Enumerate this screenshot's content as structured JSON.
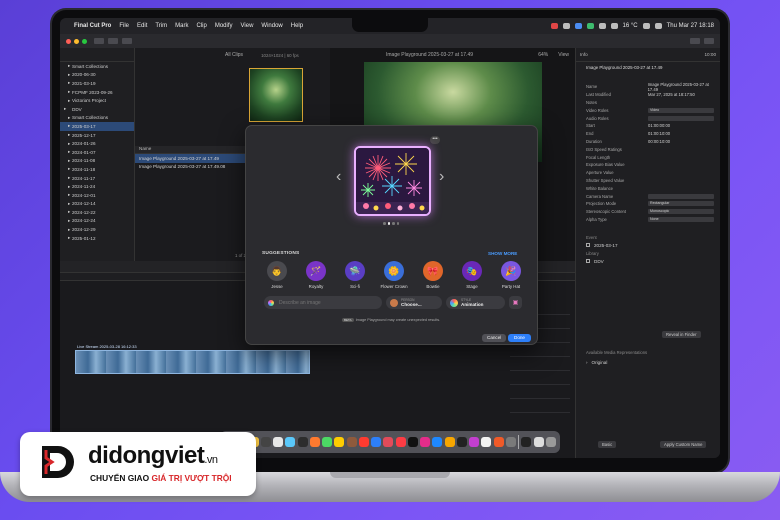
{
  "menubar": {
    "app": "Final Cut Pro",
    "items": [
      "File",
      "Edit",
      "Trim",
      "Mark",
      "Clip",
      "Modify",
      "View",
      "Window",
      "Help"
    ],
    "weather": "16 °C",
    "clock": "Thu Mar 27  18:18"
  },
  "library": {
    "items": [
      {
        "label": "Smart Collections",
        "indent": 1,
        "selected": false
      },
      {
        "label": "2020-06-30",
        "indent": 1,
        "selected": false
      },
      {
        "label": "2021-03-19",
        "indent": 1,
        "selected": false
      },
      {
        "label": "FCPMF 2023-09-26",
        "indent": 1,
        "selected": false
      },
      {
        "label": "Victoria's Project",
        "indent": 1,
        "selected": false
      },
      {
        "label": "DDV",
        "indent": 0,
        "selected": false
      },
      {
        "label": "Smart Collections",
        "indent": 1,
        "selected": false
      },
      {
        "label": "2025-03-17",
        "indent": 1,
        "selected": true
      },
      {
        "label": "2025-12-17",
        "indent": 1,
        "selected": false
      },
      {
        "label": "2024-01-26",
        "indent": 1,
        "selected": false
      },
      {
        "label": "2024-01-07",
        "indent": 1,
        "selected": false
      },
      {
        "label": "2024-11-08",
        "indent": 1,
        "selected": false
      },
      {
        "label": "2024-11-18",
        "indent": 1,
        "selected": false
      },
      {
        "label": "2024-11-17",
        "indent": 1,
        "selected": false
      },
      {
        "label": "2024-11-24",
        "indent": 1,
        "selected": false
      },
      {
        "label": "2024-12-01",
        "indent": 1,
        "selected": false
      },
      {
        "label": "2024-12-14",
        "indent": 1,
        "selected": false
      },
      {
        "label": "2024-12-22",
        "indent": 1,
        "selected": false
      },
      {
        "label": "2024-12-24",
        "indent": 1,
        "selected": false
      },
      {
        "label": "2024-12-29",
        "indent": 1,
        "selected": false
      },
      {
        "label": "2025-01-12",
        "indent": 1,
        "selected": false
      }
    ]
  },
  "browser": {
    "filter": "All Clips",
    "format": "1024×1024 | 60 fps",
    "thumb_caption": "Image Play...27 at 17:48",
    "column_header": "Name",
    "clips": [
      {
        "name": "Image Playground 2025-03-27 at 17.49",
        "selected": true
      },
      {
        "name": "Image Playground 2025-03-27 at 17.49.08",
        "selected": false
      }
    ],
    "selection_count": "1 of 2 selected, 10:00"
  },
  "viewer": {
    "title": "Image Playground 2025-03-27 at 17.49",
    "zoom": "64%",
    "view_menu": "View"
  },
  "inspector": {
    "tabs": "Info",
    "timecode": "10:00",
    "clip_name_value": "Image Playground 2025-03-27 at 17.49",
    "rows": [
      {
        "k": "Name",
        "v": "Image Playground 2025-03-27 at 17.49",
        "box": false
      },
      {
        "k": "Last Modified",
        "v": "Mar 27, 2025 at 18:17:50",
        "box": false
      },
      {
        "k": "Notes",
        "v": "",
        "box": false
      },
      {
        "k": "Video Roles",
        "v": "Video",
        "box": true
      },
      {
        "k": "Audio Roles",
        "v": "",
        "box": true
      },
      {
        "k": "Start",
        "v": "01:00:00:00",
        "box": false
      },
      {
        "k": "End",
        "v": "01:00:10:00",
        "box": false
      },
      {
        "k": "Duration",
        "v": "00:00:10:00",
        "box": false
      },
      {
        "k": "ISO Speed Ratings",
        "v": "",
        "box": false
      },
      {
        "k": "Focal Length",
        "v": "",
        "box": false
      },
      {
        "k": "Exposure Bias Value",
        "v": "",
        "box": false
      },
      {
        "k": "Aperture Value",
        "v": "",
        "box": false
      },
      {
        "k": "Shutter Speed Value",
        "v": "",
        "box": false
      },
      {
        "k": "White Balance",
        "v": "",
        "box": false
      },
      {
        "k": "Camera Name",
        "v": "",
        "box": true
      },
      {
        "k": "Projection Mode",
        "v": "Rectangular",
        "box": true
      },
      {
        "k": "Stereoscopic Content",
        "v": "Monoscopic",
        "box": true
      },
      {
        "k": "Alpha Type",
        "v": "None",
        "box": true
      }
    ],
    "event_label": "Event",
    "event_value": "2025-03-17",
    "library_label": "Library",
    "library_value": "DDV",
    "reveal_button": "Reveal in Finder",
    "media_section": "Available Media Representations",
    "original": "Original",
    "back_button": "Basic",
    "apply_button": "Apply Custom Name"
  },
  "timeline": {
    "clip_label": "Live Stream 2025-03-28 16:12:33"
  },
  "dialog": {
    "more": "•••",
    "suggestions_title": "SUGGESTIONS",
    "show_more": "SHOW MORE",
    "suggestions": [
      {
        "label": "Jesse",
        "icon": "person-avatar-icon",
        "glyph": "👨",
        "color": "#4a4a4f"
      },
      {
        "label": "Royalty",
        "icon": "scepter-icon",
        "glyph": "🪄",
        "color": "#7a34c8"
      },
      {
        "label": "Sci-fi",
        "icon": "ufo-icon",
        "glyph": "🛸",
        "color": "#5a3ec4"
      },
      {
        "label": "Flower Crown",
        "icon": "flower-crown-icon",
        "glyph": "🌼",
        "color": "#3a6ed8"
      },
      {
        "label": "Bowtie",
        "icon": "bowtie-icon",
        "glyph": "🎀",
        "color": "#e0662a"
      },
      {
        "label": "Stage",
        "icon": "stage-icon",
        "glyph": "🎭",
        "color": "#6a28b8"
      },
      {
        "label": "Party Hat",
        "icon": "party-hat-icon",
        "glyph": "🎉",
        "color": "#7a56e0"
      }
    ],
    "prompt_placeholder": "Describe an image",
    "person_caption": "PERSON",
    "person_value": "Choose...",
    "style_caption": "STYLE",
    "style_value": "Animation",
    "beta_badge": "BETA",
    "notice": "Image Playground may create unexpected results.",
    "cancel_label": "Cancel",
    "done_label": "Done"
  },
  "dock_apps": [
    "#2d7ff9",
    "#f2f2f2",
    "#f5c542",
    "#444",
    "#e7e7e7",
    "#5ac8fa",
    "#2d2d2d",
    "#ff7a2f",
    "#4cd964",
    "#ffcc00",
    "#8e5a3c",
    "#ff3b30",
    "#2d7ff9",
    "#e24b5a",
    "#fc3c44",
    "#111",
    "#e42c8a",
    "#1e88ff",
    "#f7a600",
    "#222",
    "#c33fcf",
    "#f2f2f2",
    "#f05a28",
    "#7a7a7a",
    "#222",
    "#dddddd",
    "#9a9a9a"
  ],
  "brand": {
    "name": "didongviet",
    "tld": ".vn",
    "tagline_prefix": "CHUYỂN GIAO ",
    "tagline_highlight": "GIÁ TRỊ VƯỢT TRỘI",
    "red": "#d8272a"
  }
}
